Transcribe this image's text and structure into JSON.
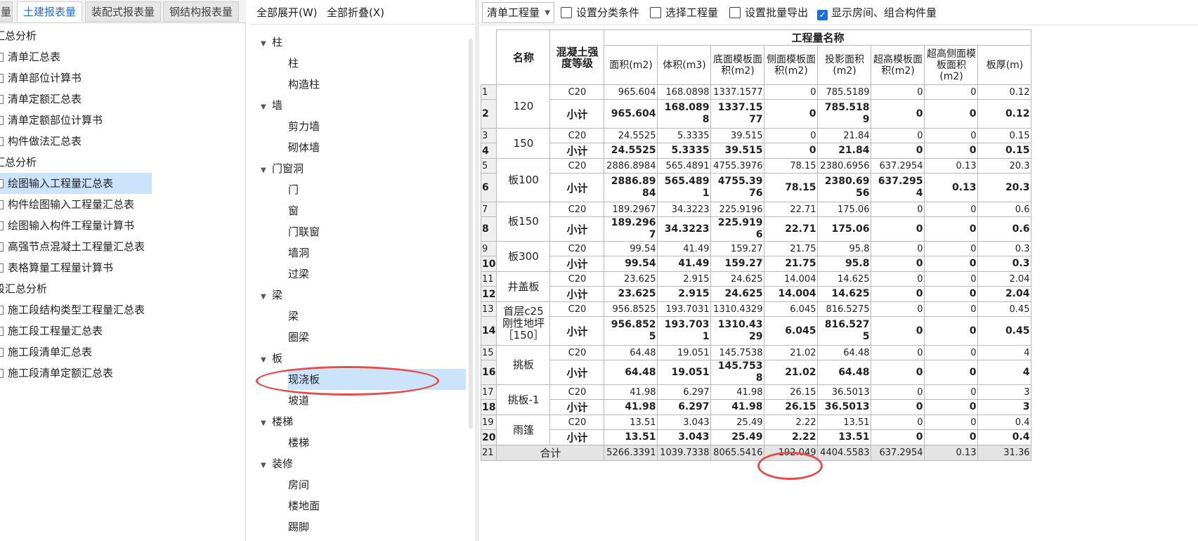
{
  "left_tabs": [
    "量",
    "土建报表量",
    "装配式报表量",
    "钢结构报表量"
  ],
  "report_tree": [
    {
      "label": "汇总分析",
      "type": "group"
    },
    {
      "label": "清单汇总表",
      "type": "item"
    },
    {
      "label": "清单部位计算书",
      "type": "item"
    },
    {
      "label": "清单定额汇总表",
      "type": "item"
    },
    {
      "label": "清单定额部位计算书",
      "type": "item"
    },
    {
      "label": "构件做法汇总表",
      "type": "item"
    },
    {
      "label": "汇总分析",
      "type": "group"
    },
    {
      "label": "绘图输入工程量汇总表",
      "type": "item",
      "selected": true
    },
    {
      "label": "构件绘图输入工程量汇总表",
      "type": "item"
    },
    {
      "label": "绘图输入构件工程量计算书",
      "type": "item"
    },
    {
      "label": "高强节点混凝土工程量汇总表",
      "type": "item"
    },
    {
      "label": "表格算量工程量计算书",
      "type": "item"
    },
    {
      "label": "段汇总分析",
      "type": "group"
    },
    {
      "label": "施工段结构类型工程量汇总表",
      "type": "item"
    },
    {
      "label": "施工段工程量汇总表",
      "type": "item"
    },
    {
      "label": "施工段清单汇总表",
      "type": "item"
    },
    {
      "label": "施工段清单定额汇总表",
      "type": "item"
    }
  ],
  "mid_toolbar": {
    "expand_all": "全部展开(W)",
    "collapse_all": "全部折叠(X)"
  },
  "category_tree": [
    {
      "label": "柱",
      "level": 0
    },
    {
      "label": "柱",
      "level": 1
    },
    {
      "label": "构造柱",
      "level": 1
    },
    {
      "label": "墙",
      "level": 0
    },
    {
      "label": "剪力墙",
      "level": 1
    },
    {
      "label": "砌体墙",
      "level": 1
    },
    {
      "label": "门窗洞",
      "level": 0
    },
    {
      "label": "门",
      "level": 1
    },
    {
      "label": "窗",
      "level": 1
    },
    {
      "label": "门联窗",
      "level": 1
    },
    {
      "label": "墙洞",
      "level": 1
    },
    {
      "label": "过梁",
      "level": 1
    },
    {
      "label": "梁",
      "level": 0
    },
    {
      "label": "梁",
      "level": 1
    },
    {
      "label": "圈梁",
      "level": 1
    },
    {
      "label": "板",
      "level": 0
    },
    {
      "label": "现浇板",
      "level": 1,
      "selected": true
    },
    {
      "label": "坡道",
      "level": 1
    },
    {
      "label": "楼梯",
      "level": 0
    },
    {
      "label": "楼梯",
      "level": 1
    },
    {
      "label": "装修",
      "level": 0
    },
    {
      "label": "房间",
      "level": 1
    },
    {
      "label": "楼地面",
      "level": 1
    },
    {
      "label": "踢脚",
      "level": 1
    }
  ],
  "right_toolbar": {
    "dropdown": "清单工程量",
    "set_category": "设置分类条件",
    "select_quantity": "选择工程量",
    "batch_export": "设置批量导出",
    "show_rooms": "显示房间、组合构件量"
  },
  "table": {
    "group_header": "工程量名称",
    "col_name": "名称",
    "col_grade": "混凝土强度等级",
    "cols": [
      "面积(m2)",
      "体积(m3)",
      "底面模板面积(m2)",
      "侧面模板面积(m2)",
      "投影面积(m2)",
      "超高模板面积(m2)",
      "超高侧面模板面积(m2)",
      "板厚(m)"
    ],
    "groups": [
      {
        "name": "120",
        "rows": [
          {
            "n": "1",
            "grade": "C20",
            "v": [
              "965.604",
              "168.0898",
              "1337.1577",
              "0",
              "785.5189",
              "0",
              "0",
              "0.12"
            ]
          },
          {
            "n": "2",
            "grade": "小计",
            "v": [
              "965.604",
              "168.0898",
              "1337.1577",
              "0",
              "785.5189",
              "0",
              "0",
              "0.12"
            ]
          }
        ]
      },
      {
        "name": "150",
        "rows": [
          {
            "n": "3",
            "grade": "C20",
            "v": [
              "24.5525",
              "5.3335",
              "39.515",
              "0",
              "21.84",
              "0",
              "0",
              "0.15"
            ]
          },
          {
            "n": "4",
            "grade": "小计",
            "v": [
              "24.5525",
              "5.3335",
              "39.515",
              "0",
              "21.84",
              "0",
              "0",
              "0.15"
            ]
          }
        ]
      },
      {
        "name": "板100",
        "rows": [
          {
            "n": "5",
            "grade": "C20",
            "v": [
              "2886.8984",
              "565.4891",
              "4755.3976",
              "78.15",
              "2380.6956",
              "637.2954",
              "0.13",
              "20.3"
            ]
          },
          {
            "n": "6",
            "grade": "小计",
            "v": [
              "2886.8984",
              "565.4891",
              "4755.3976",
              "78.15",
              "2380.6956",
              "637.2954",
              "0.13",
              "20.3"
            ]
          }
        ]
      },
      {
        "name": "板150",
        "rows": [
          {
            "n": "7",
            "grade": "C20",
            "v": [
              "189.2967",
              "34.3223",
              "225.9196",
              "22.71",
              "175.06",
              "0",
              "0",
              "0.6"
            ]
          },
          {
            "n": "8",
            "grade": "小计",
            "v": [
              "189.2967",
              "34.3223",
              "225.9196",
              "22.71",
              "175.06",
              "0",
              "0",
              "0.6"
            ]
          }
        ]
      },
      {
        "name": "板300",
        "rows": [
          {
            "n": "9",
            "grade": "C20",
            "v": [
              "99.54",
              "41.49",
              "159.27",
              "21.75",
              "95.8",
              "0",
              "0",
              "0.3"
            ]
          },
          {
            "n": "10",
            "grade": "小计",
            "v": [
              "99.54",
              "41.49",
              "159.27",
              "21.75",
              "95.8",
              "0",
              "0",
              "0.3"
            ]
          }
        ]
      },
      {
        "name": "井盖板",
        "rows": [
          {
            "n": "11",
            "grade": "C20",
            "v": [
              "23.625",
              "2.915",
              "24.625",
              "14.004",
              "14.625",
              "0",
              "0",
              "2.04"
            ]
          },
          {
            "n": "12",
            "grade": "小计",
            "v": [
              "23.625",
              "2.915",
              "24.625",
              "14.004",
              "14.625",
              "0",
              "0",
              "2.04"
            ]
          }
        ]
      },
      {
        "name": "首层c25刚性地坪［150］",
        "rows": [
          {
            "n": "13",
            "grade": "C20",
            "v": [
              "956.8525",
              "193.7031",
              "1310.4329",
              "6.045",
              "816.5275",
              "0",
              "0",
              "0.45"
            ]
          },
          {
            "n": "14",
            "grade": "小计",
            "v": [
              "956.8525",
              "193.7031",
              "1310.4329",
              "6.045",
              "816.5275",
              "0",
              "0",
              "0.45"
            ]
          }
        ]
      },
      {
        "name": "挑板",
        "rows": [
          {
            "n": "15",
            "grade": "C20",
            "v": [
              "64.48",
              "19.051",
              "145.7538",
              "21.02",
              "64.48",
              "0",
              "0",
              "4"
            ]
          },
          {
            "n": "16",
            "grade": "小计",
            "v": [
              "64.48",
              "19.051",
              "145.7538",
              "21.02",
              "64.48",
              "0",
              "0",
              "4"
            ]
          }
        ]
      },
      {
        "name": "挑板-1",
        "rows": [
          {
            "n": "17",
            "grade": "C20",
            "v": [
              "41.98",
              "6.297",
              "41.98",
              "26.15",
              "36.5013",
              "0",
              "0",
              "3"
            ]
          },
          {
            "n": "18",
            "grade": "小计",
            "v": [
              "41.98",
              "6.297",
              "41.98",
              "26.15",
              "36.5013",
              "0",
              "0",
              "3"
            ]
          }
        ]
      },
      {
        "name": "雨篷",
        "rows": [
          {
            "n": "19",
            "grade": "C20",
            "v": [
              "13.51",
              "3.043",
              "25.49",
              "2.22",
              "13.51",
              "0",
              "0",
              "0.4"
            ]
          },
          {
            "n": "20",
            "grade": "小计",
            "v": [
              "13.51",
              "3.043",
              "25.49",
              "2.22",
              "13.51",
              "0",
              "0",
              "0.4"
            ]
          }
        ]
      }
    ],
    "total": {
      "n": "21",
      "label": "合计",
      "v": [
        "5266.3391",
        "1039.7338",
        "8065.5416",
        "192.049",
        "4404.5583",
        "637.2954",
        "0.13",
        "31.36"
      ]
    }
  }
}
